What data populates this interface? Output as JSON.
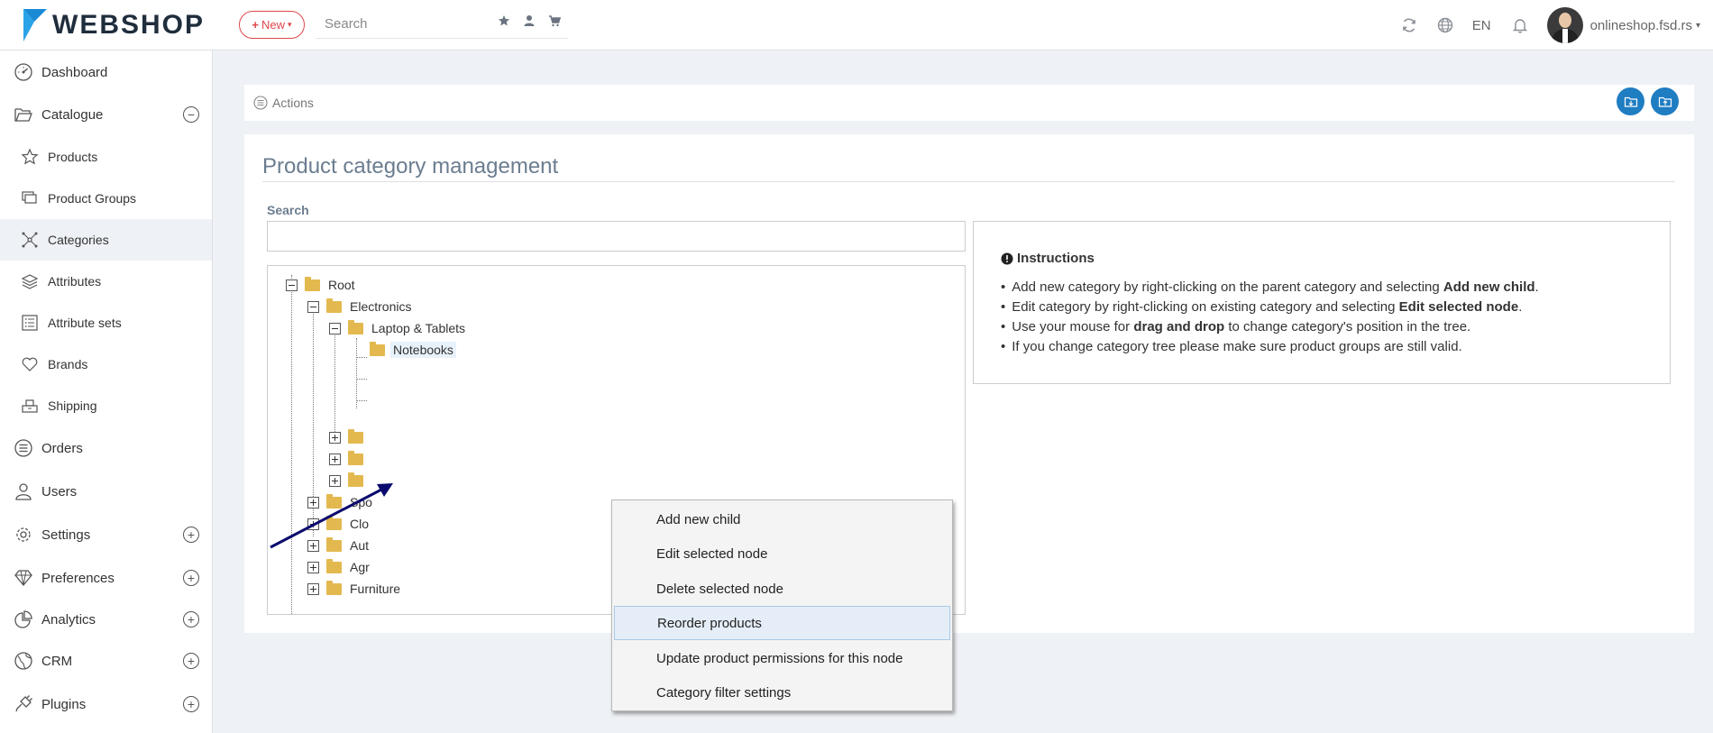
{
  "header": {
    "logo_text": "WEBSHOP",
    "new_label": "New",
    "search_placeholder": "Search",
    "language": "EN",
    "user": "onlineshop.fsd.rs"
  },
  "sidebar": {
    "items": [
      {
        "label": "Dashboard",
        "icon": "gauge-icon"
      },
      {
        "label": "Catalogue",
        "icon": "folder-open-icon",
        "toggle": "−"
      },
      {
        "label": "Products",
        "icon": "star-icon"
      },
      {
        "label": "Product Groups",
        "icon": "stack-icon"
      },
      {
        "label": "Categories",
        "icon": "network-icon"
      },
      {
        "label": "Attributes",
        "icon": "layers-icon"
      },
      {
        "label": "Attribute sets",
        "icon": "list-icon"
      },
      {
        "label": "Brands",
        "icon": "heart-icon"
      },
      {
        "label": "Shipping",
        "icon": "box-icon"
      },
      {
        "label": "Orders",
        "icon": "list-circle-icon"
      },
      {
        "label": "Users",
        "icon": "user-icon"
      },
      {
        "label": "Settings",
        "icon": "gear-icon",
        "toggle": "+"
      },
      {
        "label": "Preferences",
        "icon": "diamond-icon",
        "toggle": "+"
      },
      {
        "label": "Analytics",
        "icon": "pie-chart-icon",
        "toggle": "+"
      },
      {
        "label": "CRM",
        "icon": "globe-icon",
        "toggle": "+"
      },
      {
        "label": "Plugins",
        "icon": "plug-icon",
        "toggle": "+"
      }
    ]
  },
  "actions": {
    "label": "Actions"
  },
  "main": {
    "title": "Product category management",
    "search_label": "Search"
  },
  "tree": {
    "nodes": [
      {
        "label": "Root"
      },
      {
        "label": "Electronics"
      },
      {
        "label": "Laptop & Tablets"
      },
      {
        "label": "Notebooks"
      },
      {
        "label": "Spo"
      },
      {
        "label": "Clo"
      },
      {
        "label": "Aut"
      },
      {
        "label": "Agr"
      },
      {
        "label": "Furniture"
      }
    ]
  },
  "context_menu": {
    "items": [
      "Add new child",
      "Edit selected node",
      "Delete selected node",
      "Reorder products",
      "Update product permissions for this node",
      "Category filter settings"
    ]
  },
  "instructions": {
    "title": "Instructions",
    "lines": [
      {
        "pre": "Add new category by right-clicking on the parent category and selecting ",
        "bold": "Add new child",
        "post": "."
      },
      {
        "pre": "Edit category by right-clicking on existing category and selecting ",
        "bold": "Edit selected node",
        "post": "."
      },
      {
        "pre": "Use your mouse for ",
        "bold": "drag and drop",
        "post": " to change category's position in the tree."
      },
      {
        "pre": "If you change category tree please make sure product groups are still valid.",
        "bold": "",
        "post": ""
      }
    ]
  },
  "colors": {
    "accent": "#1f7dc2",
    "new_button": "#e0454a",
    "folder": "#e3b94f",
    "arrow": "#0a0a6e"
  }
}
